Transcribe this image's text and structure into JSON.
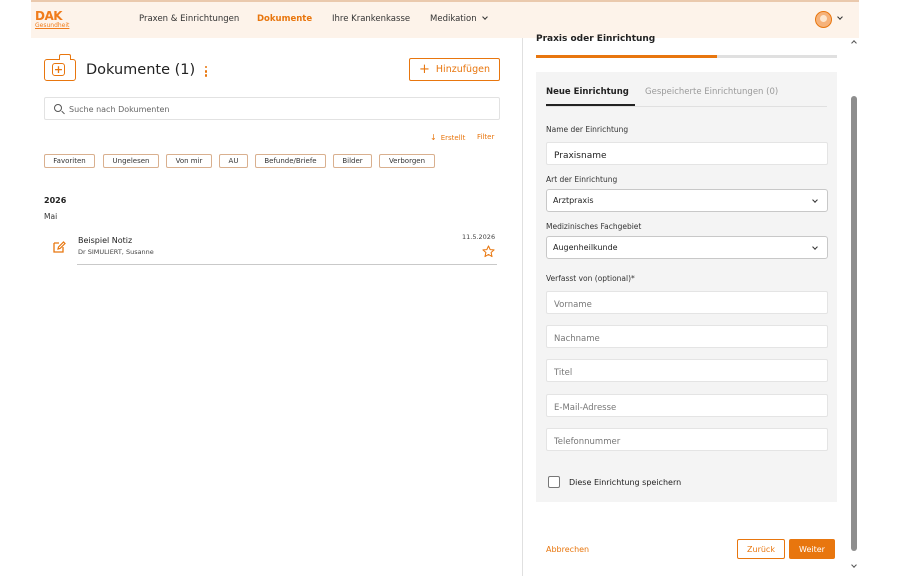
{
  "header": {
    "logo": {
      "brand": "DAK",
      "sub": "Gesundheit"
    },
    "nav": [
      {
        "label": "Praxen & Einrichtungen"
      },
      {
        "label": "Dokumente",
        "active": true
      },
      {
        "label": "Ihre Krankenkasse"
      },
      {
        "label": "Medikation",
        "has_dropdown": true
      }
    ],
    "avatar_icon": "user-avatar-icon"
  },
  "documents": {
    "title": "Dokumente (1)",
    "add_button": "Hinzufügen",
    "search_placeholder": "Suche nach Dokumenten",
    "sort_label": "Erstellt",
    "filter_label": "Filter",
    "chips": [
      "Favoriten",
      "Ungelesen",
      "Von mir",
      "AU",
      "Befunde/Briefe",
      "Bilder",
      "Verborgen"
    ],
    "groups": [
      {
        "year": "2026",
        "month": "Mai",
        "items": [
          {
            "title": "Beispiel Notiz",
            "author": "Dr SIMULIERT, Susanne",
            "date": "11.5.2026",
            "icon": "edit-note-icon",
            "favorite": false
          }
        ]
      }
    ]
  },
  "form": {
    "title": "Praxis oder Einrichtung",
    "progress": 0.6,
    "tabs": [
      "Neue Einrichtung",
      "Gespeicherte Einrichtungen (0)"
    ],
    "name_label": "Name der Einrichtung",
    "name_value": "Praxisname",
    "type_label": "Art der Einrichtung",
    "type_value": "Arztpraxis",
    "field_label": "Medizinisches Fachgebiet",
    "field_value": "Augenheilkunde",
    "author_label": "Verfasst von (optional)*",
    "placeholders": {
      "first_name": "Vorname",
      "last_name": "Nachname",
      "title": "Titel",
      "email": "E-Mail-Adresse",
      "phone": "Telefonnummer"
    },
    "save_checkbox_label": "Diese Einrichtung speichern",
    "save_checked": false,
    "cancel": "Abbrechen",
    "back": "Zurück",
    "next": "Weiter"
  },
  "colors": {
    "accent": "#e8760e",
    "header_bg": "#fdf3ea",
    "card_bg": "#f4f4f4"
  }
}
